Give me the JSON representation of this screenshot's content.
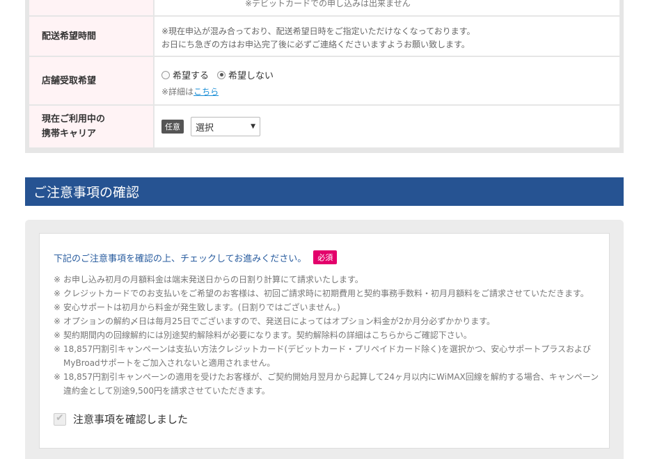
{
  "form": {
    "top_note": "※デビットカードでの申し込みは出来ません",
    "rows": [
      {
        "label": "配送希望時間",
        "text1": "※現在申込が混み合っており、配送希望日時をご指定いただけなくなっております。",
        "text2": "お日にち急ぎの方はお申込完了後に必ずご連絡くださいますようお願い致します。"
      },
      {
        "label": "店舗受取希望",
        "option_yes": "希望する",
        "option_no": "希望しない",
        "selected": "希望しない",
        "detail_prefix": "※詳細は",
        "detail_link": "こちら"
      },
      {
        "label_line1": "現在ご利用中の",
        "label_line2": "携帯キャリア",
        "badge": "任意",
        "select_value": "選択"
      }
    ]
  },
  "notice": {
    "section_title": "ご注意事項の確認",
    "lead": "下記のご注意事項を確認の上、チェックしてお進みください。",
    "required_badge": "必須",
    "notes": [
      "お申し込み初月の月額料金は端末発送日からの日割り計算にて請求いたします。",
      "クレジットカードでのお支払いをご希望のお客様は、初回ご請求時に初期費用と契約事務手数料・初月月額料をご請求させていただきます。",
      "安心サポートは初月から料金が発生致します。(日割りではございません。)",
      "オプションの解約〆日は毎月25日でございますので、発送日によってはオプション料金が2か月分必ずかかります。",
      "契約期間内の回線解約には別途契約解除料が必要になります。契約解除料の詳細はこちらからご確認下さい。",
      "18,857円割引キャンペーンは支払い方法クレジットカード(デビットカード・プリペイドカード除く)を選択かつ、安心サポートプラスおよびMyBroadサポートをご加入されないと適用されません。",
      "18,857円割引キャンペーンの適用を受けたお客様が、ご契約開始月翌月から起算して24ヶ月以内にWiMAX回線を解約する場合、キャンペーン違約金として別途9,500円を請求させていただきます。"
    ],
    "note_mark": "※",
    "checkbox_label": "注意事項を確認しました",
    "checked": true
  },
  "colors": {
    "header_bg": "#265392",
    "required": "#e3006b",
    "link": "#1a8ed6"
  }
}
